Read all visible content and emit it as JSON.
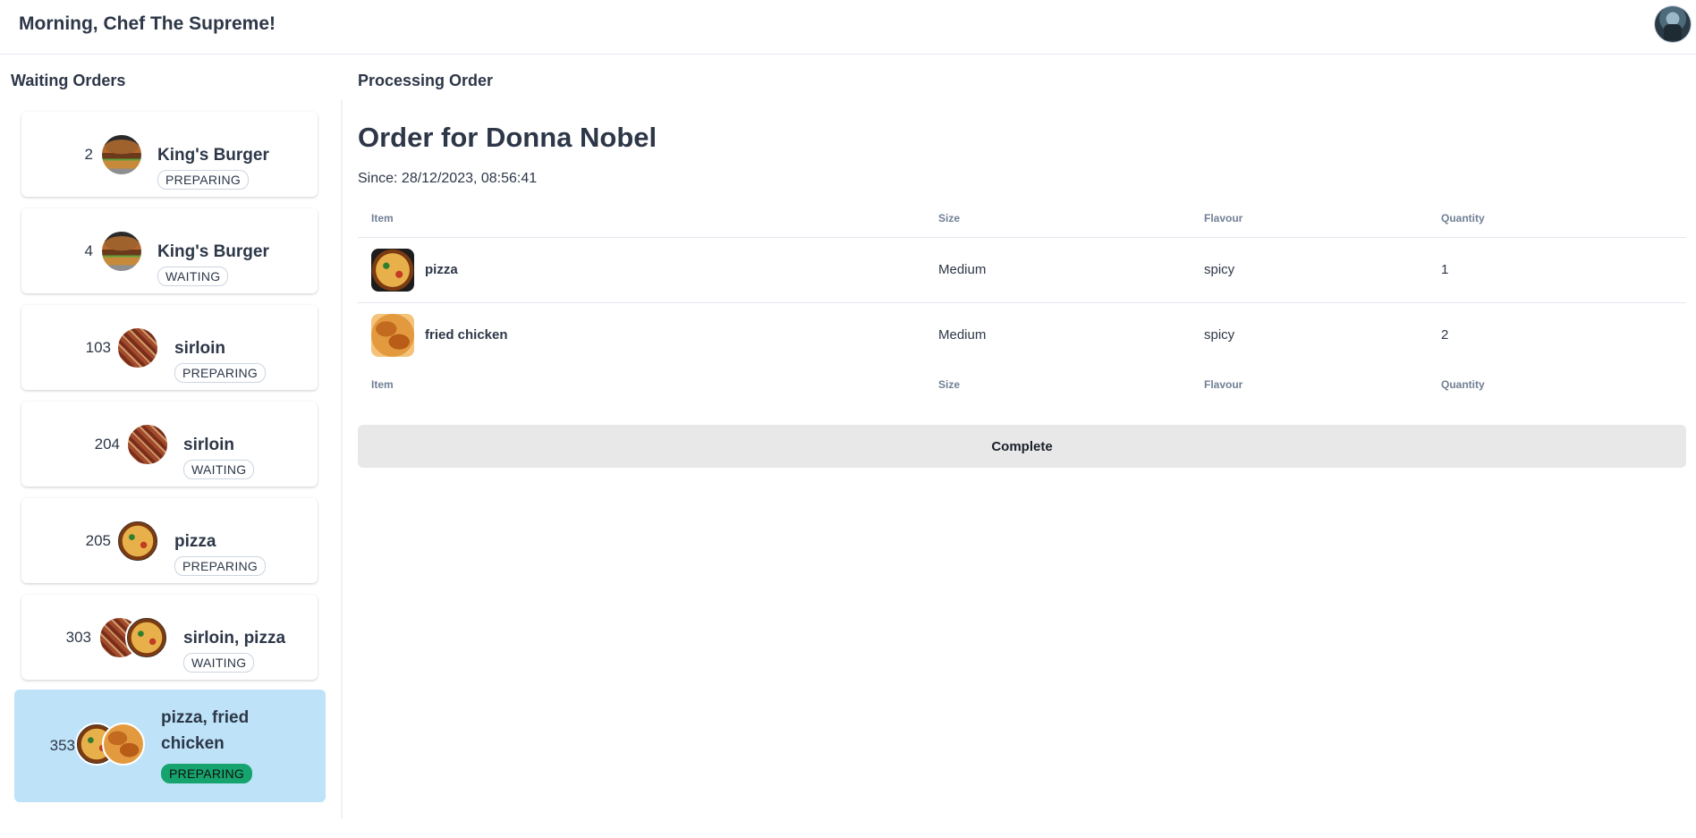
{
  "header": {
    "greeting": "Morning, Chef The Supreme!",
    "avatar_icon": "user-avatar-icon"
  },
  "waiting": {
    "title": "Waiting Orders",
    "orders": [
      {
        "number": "2",
        "name": "King's Burger",
        "status": "PREPARING",
        "images": [
          "burger"
        ]
      },
      {
        "number": "4",
        "name": "King's Burger",
        "status": "WAITING",
        "images": [
          "burger"
        ]
      },
      {
        "number": "103",
        "name": "sirloin",
        "status": "PREPARING",
        "images": [
          "steak"
        ]
      },
      {
        "number": "204",
        "name": "sirloin",
        "status": "WAITING",
        "images": [
          "steak"
        ]
      },
      {
        "number": "205",
        "name": "pizza",
        "status": "PREPARING",
        "images": [
          "pizza"
        ]
      },
      {
        "number": "303",
        "name": "sirloin, pizza",
        "status": "WAITING",
        "images": [
          "steak",
          "pizza"
        ]
      },
      {
        "number": "353",
        "name_line1": "pizza, fried",
        "name_line2": "chicken",
        "status": "PREPARING",
        "images": [
          "pizza",
          "chicken"
        ],
        "selected": true
      }
    ]
  },
  "processing": {
    "section_title": "Processing Order",
    "order_title": "Order for Donna Nobel",
    "since": "Since: 28/12/2023, 08:56:41",
    "columns": [
      "Item",
      "Size",
      "Flavour",
      "Quantity"
    ],
    "items": [
      {
        "item": "pizza",
        "size": "Medium",
        "flavour": "spicy",
        "quantity": "1",
        "image": "pizza"
      },
      {
        "item": "fried chicken",
        "size": "Medium",
        "flavour": "spicy",
        "quantity": "2",
        "image": "chicken"
      }
    ],
    "complete_label": "Complete"
  },
  "colors": {
    "selected_card": "#bee3f8",
    "preparing_badge_active": "#16a46e"
  }
}
